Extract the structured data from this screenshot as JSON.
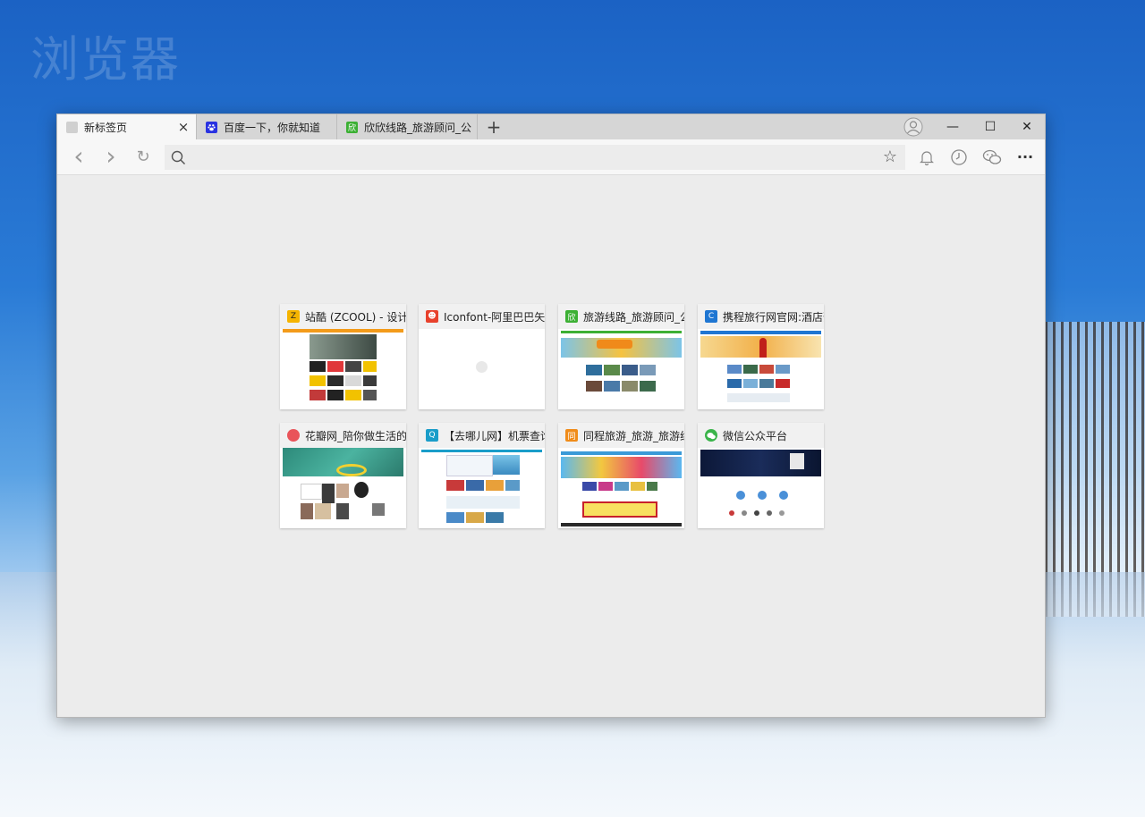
{
  "desktop": {
    "watermark": "浏览器"
  },
  "tabs": [
    {
      "label": "新标签页",
      "active": true,
      "favicon": "blank-page-icon",
      "color": "#d0d0d0"
    },
    {
      "label": "百度一下，你就知道",
      "active": false,
      "favicon": "baidu-paw-icon",
      "color": "#2932e1"
    },
    {
      "label": "欣欣线路_旅游顾问_公",
      "active": false,
      "favicon": "xinxin-icon",
      "color": "#3cb034"
    }
  ],
  "tabbar": {
    "new_tab": "+",
    "close": "×"
  },
  "window": {
    "minimize": "—",
    "maximize": "☐",
    "close": "✕"
  },
  "toolbar": {
    "back": "‹",
    "forward": "›",
    "refresh": "↻",
    "address_placeholder": "",
    "address_value": "",
    "favorite": "☆",
    "notifications": "bell-icon",
    "history": "clock-icon",
    "wechat": "wechat-icon",
    "more": "···"
  },
  "tiles": [
    {
      "title": "站酷 (ZCOOL) - 设计师",
      "favicon_color": "#f5b400",
      "favicon_text": "Z"
    },
    {
      "title": "Iconfont-阿里巴巴矢量",
      "favicon_color": "#e8412c",
      "favicon_text": "I"
    },
    {
      "title": "旅游线路_旅游顾问_公",
      "favicon_color": "#3cb034",
      "favicon_text": "欣"
    },
    {
      "title": "携程旅行网官网:酒店预",
      "favicon_color": "#1f76d2",
      "favicon_text": "C"
    },
    {
      "title": "花瓣网_陪你做生活的设",
      "favicon_color": "#e9545a",
      "favicon_text": "花"
    },
    {
      "title": "【去哪儿网】机票查询",
      "favicon_color": "#1a9dc9",
      "favicon_text": "Q"
    },
    {
      "title": "同程旅游_旅游_旅游线",
      "favicon_color": "#f08c1a",
      "favicon_text": "同"
    },
    {
      "title": "微信公众平台",
      "favicon_color": "#3ab44a",
      "favicon_text": "微"
    }
  ]
}
